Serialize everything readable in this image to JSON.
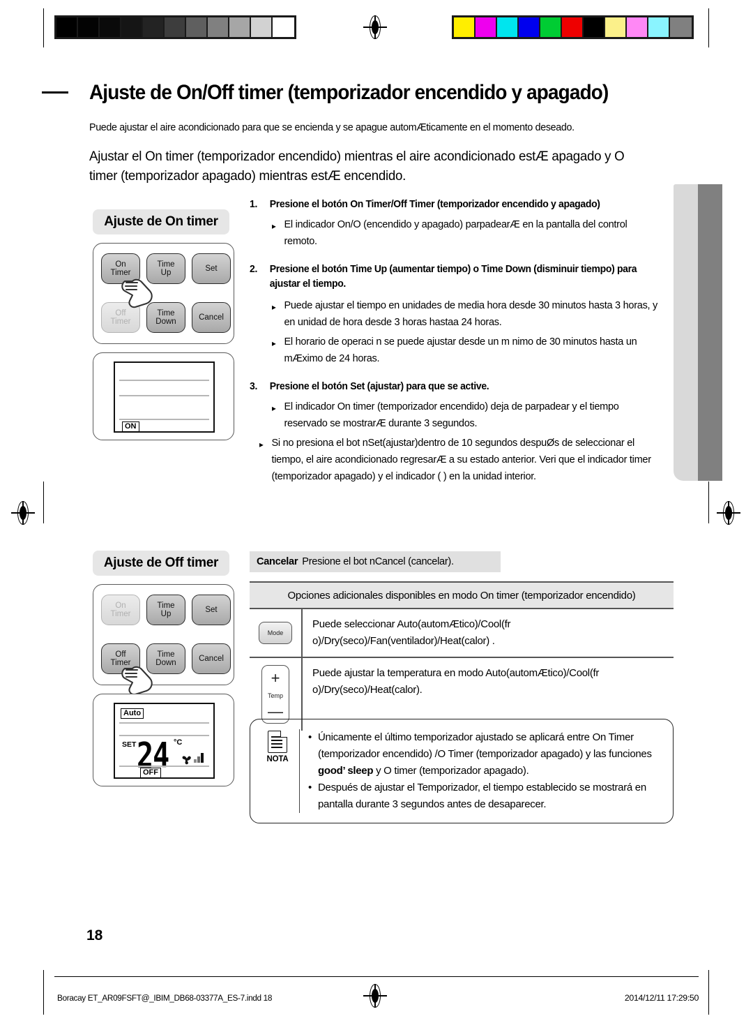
{
  "print_marks": {
    "grayscale_swatches": [
      "#000000",
      "#030303",
      "#0a0a0a",
      "#151515",
      "#232323",
      "#3d3d3d",
      "#5f5f5f",
      "#808080",
      "#a6a6a6",
      "#d2d2d2",
      "#ffffff"
    ],
    "color_swatches": [
      "#ffee00",
      "#ee00ee",
      "#00e5ee",
      "#0000ee",
      "#00cc33",
      "#ee0000",
      "#000000",
      "#fbf08a",
      "#ff88f5",
      "#8af4ff",
      "#808080"
    ],
    "registration_icon": "registration-target-icon"
  },
  "header": {
    "title": "Ajuste de On/Off timer (temporizador encendido y apagado)",
    "intro": "Puede ajustar el aire acondicionado para que se encienda y se apague automÆticamente en el momento deseado.",
    "lead": "Ajustar el On timer (temporizador encendido) mientras el aire acondicionado estÆ apagado y O  timer (temporizador apagado) mientras estÆ encendido."
  },
  "on_timer_panel": {
    "heading": "Ajuste de On timer",
    "keys": [
      {
        "line1": "On",
        "line2": "Timer",
        "state": "active"
      },
      {
        "line1": "Time",
        "line2": "Up",
        "state": "active"
      },
      {
        "line1": "Set",
        "line2": "",
        "state": "active"
      },
      {
        "line1": "Off",
        "line2": "Timer",
        "state": "dim"
      },
      {
        "line1": "Time",
        "line2": "Down",
        "state": "active"
      },
      {
        "line1": "Cancel",
        "line2": "",
        "state": "active"
      }
    ],
    "pressed_key": "On Timer",
    "lcd": {
      "indicator": "ON"
    }
  },
  "off_timer_panel": {
    "heading": "Ajuste de Off timer",
    "keys": [
      {
        "line1": "On",
        "line2": "Timer",
        "state": "dim"
      },
      {
        "line1": "Time",
        "line2": "Up",
        "state": "active"
      },
      {
        "line1": "Set",
        "line2": "",
        "state": "active"
      },
      {
        "line1": "Off",
        "line2": "Timer",
        "state": "active"
      },
      {
        "line1": "Time",
        "line2": "Down",
        "state": "active"
      },
      {
        "line1": "Cancel",
        "line2": "",
        "state": "active"
      }
    ],
    "pressed_key": "Off Timer",
    "lcd": {
      "mode": "Auto",
      "set_label": "SET",
      "temperature": "24",
      "unit": "°C",
      "fan_icon": "fan-icon",
      "fan_bars": 3,
      "indicator": "OFF"
    }
  },
  "steps": [
    {
      "num": "1.",
      "head": "Presione el botón On Timer/Off Timer (temporizador encendido y apagado)",
      "bullets": [
        "El indicador On/O  (encendido y apagado) parpadearÆ en la pantalla del control remoto."
      ]
    },
    {
      "num": "2.",
      "head": "Presione el botón Time Up (aumentar tiempo) o Time Down (disminuir tiempo) para ajustar el tiempo.",
      "bullets": [
        "Puede ajustar el tiempo en unidades de media hora desde 30 minutos hasta 3 horas, y en unidad de hora desde 3 horas hastaa 24 horas.",
        "El horario de operaci n se puede ajustar desde un m nimo de 30 minutos hasta un mÆximo de 24 horas."
      ]
    },
    {
      "num": "3.",
      "head": "Presione el botón Set (ajustar) para que se active.",
      "bullets": [
        "El indicador On timer (temporizador encendido) deja de parpadear y el tiempo reservado se mostrarÆ durante 3 segundos.",
        "Si no presiona el bot nSet(ajustar)dentro de 10 segundos despuØs de seleccionar el tiempo, el aire acondicionado regresarÆ a su estado anterior. Veri que el indicador  timer (temporizador apagado) y el indicador ( ) en la unidad interior."
      ]
    }
  ],
  "cancel_strip": {
    "label": "Cancelar",
    "text": "Presione el bot nCancel (cancelar)."
  },
  "options_table": {
    "header": "Opciones adicionales disponibles en modo On timer (temporizador encendido)",
    "rows": [
      {
        "icon_name": "mode-button-icon",
        "icon_label": "Mode",
        "text": "Puede seleccionar Auto(automÆtico)/Cool(fr o)/Dry(seco)/Fan(ventilador)/Heat(calor) ."
      },
      {
        "icon_name": "temp-button-icon",
        "icon_plus": "+",
        "icon_label": "Temp",
        "icon_minus": "—",
        "text": "Puede ajustar la temperatura en modo Auto(automÆtico)/Cool(fr o)/Dry(seco)/Heat(calor)."
      }
    ]
  },
  "nota": {
    "label": "NOTA",
    "icon_name": "note-document-icon",
    "items": [
      {
        "prefix": "Únicamente el último temporizador ajustado se aplicará entre On Timer (temporizador encendido) /O  Timer (temporizador apagado) y las funciones ",
        "bold": "good’ sleep",
        "suffix": " y O  timer (temporizador apagado)."
      },
      {
        "prefix": "Después de ajustar el Temporizador, el tiempo establecido se mostrará en pantalla durante 3 segundos antes de desaparecer.",
        "bold": "",
        "suffix": ""
      }
    ]
  },
  "footer": {
    "page_number": "18",
    "file_name": "Boracay ET_AR09FSFT@_IBIM_DB68-03377A_ES-7.indd   18",
    "timestamp": "2014/12/11   17:29:50"
  }
}
